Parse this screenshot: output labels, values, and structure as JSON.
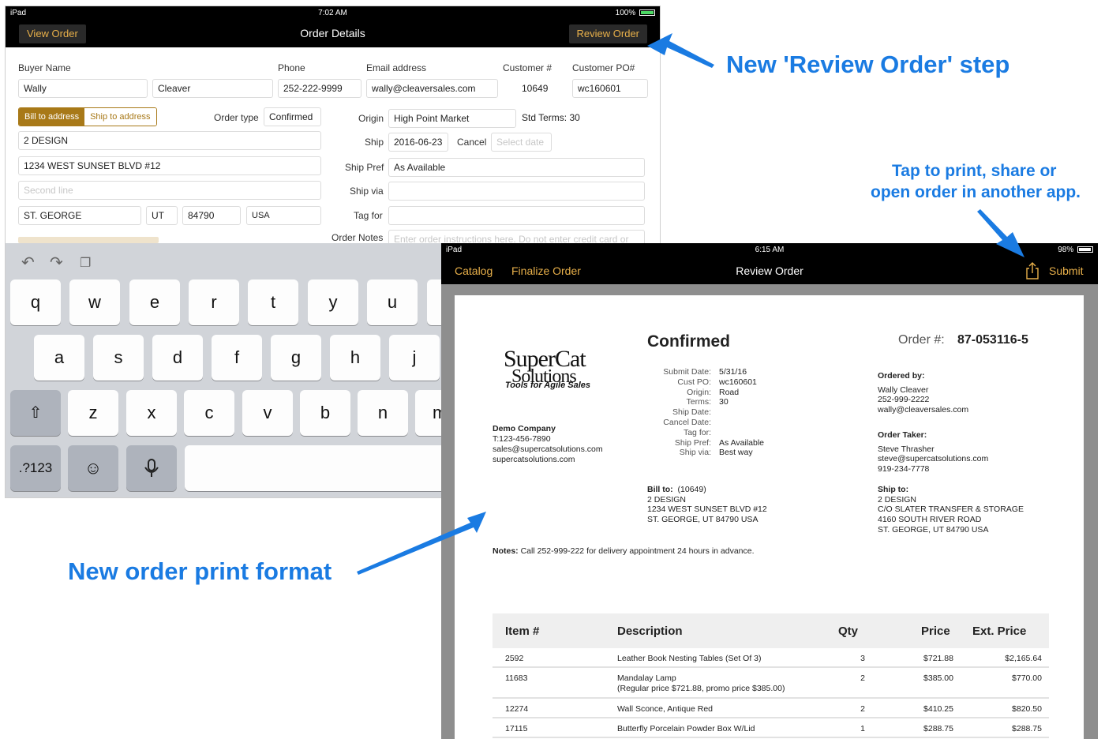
{
  "annotations": {
    "review_step": "New 'Review Order' step",
    "tap_print_1": "Tap to print, share or",
    "tap_print_2": "open order in another app.",
    "print_format": "New order print format",
    "color": "#1a7be2"
  },
  "screen1": {
    "status": {
      "device": "iPad",
      "time": "7:02 AM",
      "battery": "100%"
    },
    "nav": {
      "left": "View Order",
      "title": "Order Details",
      "right": "Review Order"
    },
    "labels": {
      "buyer_name": "Buyer Name",
      "phone": "Phone",
      "email": "Email address",
      "customer_num": "Customer #",
      "customer_po": "Customer PO#",
      "order_type": "Order type",
      "origin": "Origin",
      "ship": "Ship",
      "cancel": "Cancel",
      "ship_pref": "Ship Pref",
      "ship_via": "Ship via",
      "tag_for": "Tag for",
      "order_notes": "Order Notes"
    },
    "values": {
      "first_name": "Wally",
      "last_name": "Cleaver",
      "phone": "252-222-9999",
      "email": "wally@cleaversales.com",
      "customer_num": "10649",
      "customer_po": "wc160601",
      "order_type": "Confirmed",
      "origin": "High Point Market",
      "std_terms": "Std Terms: 30",
      "ship_date": "2016-06-23",
      "ship_pref": "As Available",
      "address_name": "2 DESIGN",
      "address_line1": "1234 WEST SUNSET BLVD #12",
      "city": "ST. GEORGE",
      "state": "UT",
      "zip": "84790",
      "country": "USA"
    },
    "placeholders": {
      "cancel_date": "Select date",
      "second_line": "Second line",
      "order_notes": "Enter order instructions here. Do not enter credit card or"
    },
    "segment": {
      "bill": "Bill to address",
      "ship": "Ship to address"
    },
    "keyboard": {
      "row1": [
        "q",
        "w",
        "e",
        "r",
        "t",
        "y",
        "u"
      ],
      "row2": [
        "a",
        "s",
        "d",
        "f",
        "g",
        "h",
        "j"
      ],
      "row3": [
        "z",
        "x",
        "c",
        "v",
        "b",
        "n",
        "m"
      ],
      "numbers": ".?123"
    }
  },
  "screen2": {
    "status": {
      "device": "iPad",
      "time": "6:15 AM",
      "battery": "98%"
    },
    "nav": {
      "catalog": "Catalog",
      "finalize": "Finalize Order",
      "title": "Review Order",
      "submit": "Submit"
    },
    "logo": {
      "line1": "SuperCat",
      "line2": "Solutions",
      "tagline": "Tools for Agile Sales"
    },
    "company": {
      "name": "Demo Company",
      "phone": "T:123-456-7890",
      "email": "sales@supercatsolutions.com",
      "web": "supercatsolutions.com"
    },
    "status_title": "Confirmed",
    "order_no_label": "Order #:",
    "order_no": "87-053116-5",
    "details": [
      {
        "label": "Submit Date:",
        "value": "5/31/16"
      },
      {
        "label": "Cust PO:",
        "value": "wc160601"
      },
      {
        "label": "Origin:",
        "value": "Road"
      },
      {
        "label": "Terms:",
        "value": "30"
      },
      {
        "label": "Ship Date:",
        "value": ""
      },
      {
        "label": "Cancel Date:",
        "value": ""
      },
      {
        "label": "Tag for:",
        "value": ""
      },
      {
        "label": "Ship Pref:",
        "value": "As Available"
      },
      {
        "label": "Ship via:",
        "value": "Best way"
      }
    ],
    "ordered_by": {
      "label": "Ordered by:",
      "name": "Wally Cleaver",
      "phone": "252-999-2222",
      "email": "wally@cleaversales.com"
    },
    "order_taker": {
      "label": "Order Taker:",
      "name": "Steve Thrasher",
      "email": "steve@supercatsolutions.com",
      "phone": "919-234-7778"
    },
    "bill_to": {
      "label": "Bill to:",
      "id": "(10649)",
      "line1": "2 DESIGN",
      "line2": "1234 WEST SUNSET BLVD #12",
      "line3": "ST. GEORGE, UT 84790 USA"
    },
    "ship_to": {
      "label": "Ship to:",
      "line1": "2 DESIGN",
      "line2": "C/O SLATER TRANSFER & STORAGE",
      "line3": "4160 SOUTH RIVER ROAD",
      "line4": "ST. GEORGE, UT 84790 USA"
    },
    "notes": {
      "label": "Notes:",
      "text": "Call 252-999-222 for delivery appointment 24 hours in advance."
    },
    "table": {
      "headers": {
        "item": "Item #",
        "desc": "Description",
        "qty": "Qty",
        "price": "Price",
        "ext": "Ext. Price"
      },
      "rows": [
        {
          "item": "2592",
          "desc": "Leather Book Nesting Tables (Set Of 3)",
          "desc2": "",
          "qty": "3",
          "price": "$721.88",
          "ext": "$2,165.64"
        },
        {
          "item": "11683",
          "desc": "Mandalay Lamp",
          "desc2": "(Regular price $721.88, promo price $385.00)",
          "qty": "2",
          "price": "$385.00",
          "ext": "$770.00"
        },
        {
          "item": "12274",
          "desc": "Wall Sconce, Antique Red",
          "desc2": "",
          "qty": "2",
          "price": "$410.25",
          "ext": "$820.50"
        },
        {
          "item": "17115",
          "desc": "Butterfly Porcelain Powder Box W/Lid",
          "desc2": "",
          "qty": "1",
          "price": "$288.75",
          "ext": "$288.75"
        }
      ]
    }
  }
}
